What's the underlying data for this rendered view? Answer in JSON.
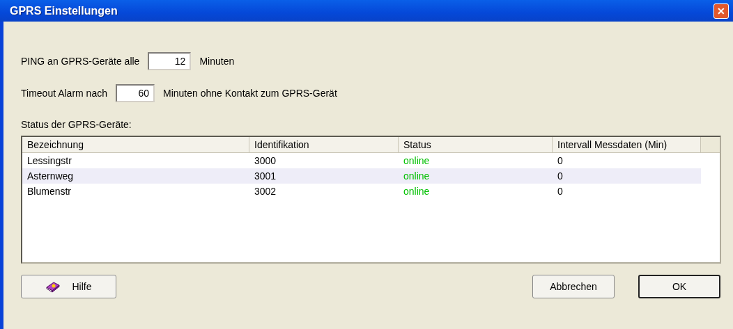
{
  "window": {
    "title": "GPRS Einstellungen",
    "close": "✕"
  },
  "ping": {
    "label": "PING an GPRS-Geräte alle",
    "value": "12",
    "unit": "Minuten"
  },
  "timeout": {
    "label": "Timeout Alarm nach",
    "value": "60",
    "unit": "Minuten ohne Kontakt zum GPRS-Gerät"
  },
  "status_label": "Status der GPRS-Geräte:",
  "table": {
    "columns": [
      "Bezeichnung",
      "Identifikation",
      "Status",
      "Intervall Messdaten (Min)"
    ],
    "rows": [
      {
        "name": "Lessingstr",
        "id": "3000",
        "status": "online",
        "color": "#00c000",
        "interval": "0"
      },
      {
        "name": "Asternweg",
        "id": "3001",
        "status": "online",
        "color": "#00c000",
        "interval": "0"
      },
      {
        "name": "Blumenstr",
        "id": "3002",
        "status": "online",
        "color": "#00c000",
        "interval": "0"
      }
    ]
  },
  "buttons": {
    "help": "Hilfe",
    "cancel": "Abbrechen",
    "ok": "OK"
  }
}
